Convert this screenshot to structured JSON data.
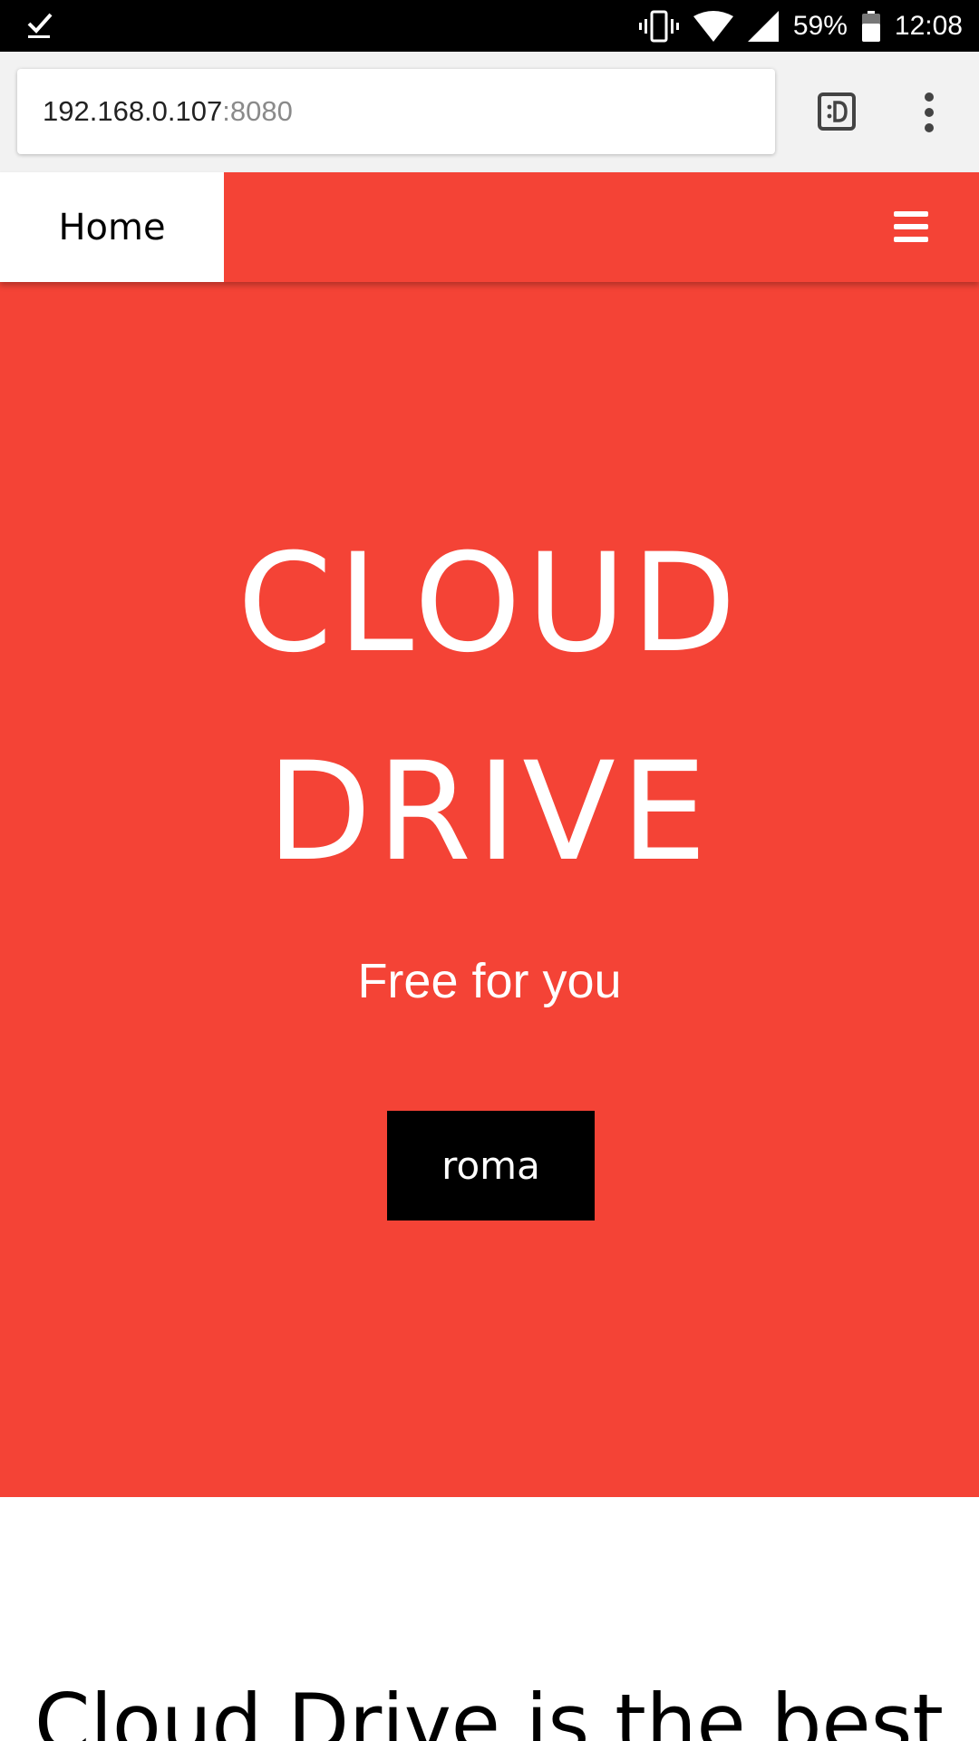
{
  "status_bar": {
    "battery_percent": "59%",
    "time": "12:08",
    "icons": [
      "check-notification-icon",
      "vibrate-icon",
      "wifi-icon",
      "signal-icon",
      "battery-icon"
    ]
  },
  "browser": {
    "url_host": "192.168.0.107",
    "url_port": ":8080",
    "icons": [
      "tab-switcher-icon",
      "more-options-icon"
    ]
  },
  "navbar": {
    "home_label": "Home",
    "menu_icon": "hamburger-menu-icon",
    "bg_color": "#f44336"
  },
  "hero": {
    "title_line1": "CLOUD",
    "title_line2": "DRIVE",
    "subtitle": "Free for you",
    "button_label": "roma"
  },
  "content": {
    "heading": "Cloud Drive is the best"
  }
}
